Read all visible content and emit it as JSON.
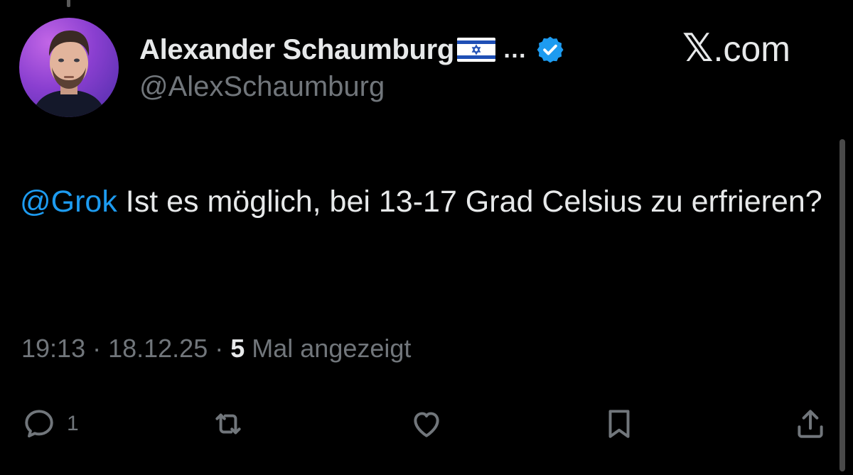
{
  "author": {
    "display_name": "Alexander Schaumburg",
    "flag": "Israel flag emoji",
    "truncation": "…",
    "verified": true,
    "handle": "@AlexSchaumburg"
  },
  "site_label": {
    "mark": "𝕏",
    "text": ".com"
  },
  "tweet": {
    "mention": "@Grok",
    "text": " Ist es möglich, bei 13-17 Grad Celsius zu erfrieren?"
  },
  "meta": {
    "time": "19:13",
    "separator_1": " · ",
    "date": "18.12.25",
    "separator_2": " · ",
    "views_count": "5",
    "views_label": " Mal angezeigt"
  },
  "actions": {
    "reply_count": "1",
    "icons": [
      "reply-icon",
      "retweet-icon",
      "like-icon",
      "bookmark-icon",
      "share-icon"
    ]
  },
  "colors": {
    "background": "#000000",
    "text": "#e7e9ea",
    "secondary": "#71767b",
    "accent": "#1d9bf0"
  }
}
